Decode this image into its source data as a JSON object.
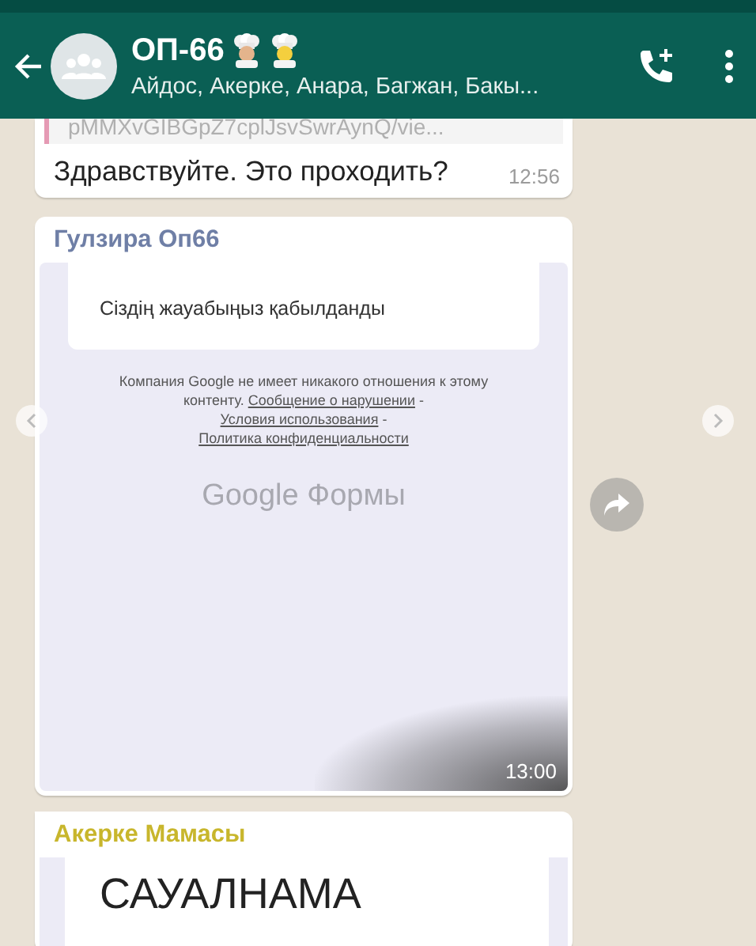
{
  "header": {
    "title": "ОП-66",
    "subtitle": "Айдос, Акерке, Анара, Багжан, Бакы..."
  },
  "messages": [
    {
      "kind": "text",
      "link_preview": "pMMXvGIBGpZ7cplJsvSwrAynQ/vie...",
      "text": "Здравствуйте. Это проходить?",
      "time": "12:56"
    },
    {
      "kind": "form",
      "sender": "Гулзира Оп66",
      "color": "#6f7fa6",
      "confirmation": "Сіздің жауабыңыз қабылданды",
      "disclaimer": [
        {
          "text": "Компания Google не имеет никакого отношения к этому контенту. ",
          "link": false
        },
        {
          "text": "Сообщение о нарушении",
          "link": true
        },
        {
          "text": " - ",
          "link": false
        },
        {
          "text": "Условия использования",
          "link": true
        },
        {
          "text": " - ",
          "link": false
        },
        {
          "text": "Политика конфиденциальности",
          "link": true
        }
      ],
      "logo": "Google Формы",
      "time": "13:00"
    },
    {
      "kind": "survey",
      "sender": "Акерке Мамасы",
      "color": "#c8b62c",
      "heading": "САУАЛНАМА"
    }
  ]
}
